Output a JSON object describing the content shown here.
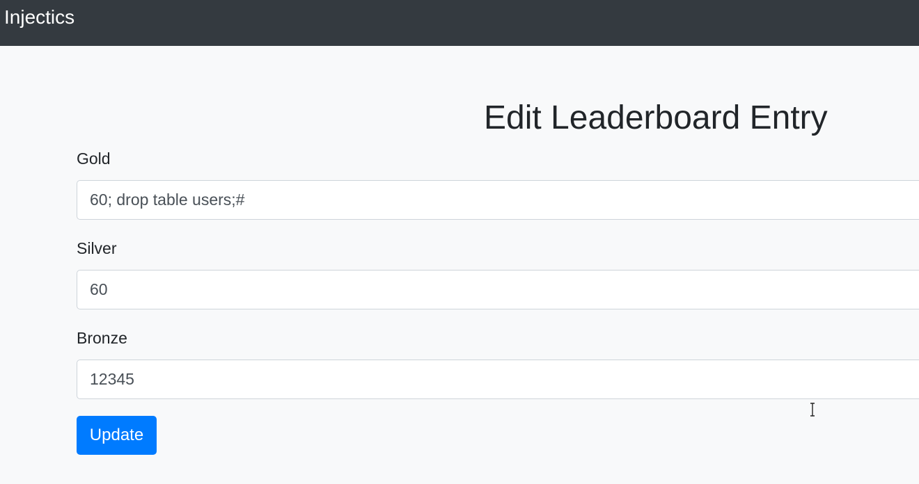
{
  "navbar": {
    "brand": "Injectics"
  },
  "page": {
    "title": "Edit Leaderboard Entry"
  },
  "form": {
    "gold": {
      "label": "Gold",
      "value": "60; drop table users;#"
    },
    "silver": {
      "label": "Silver",
      "value": "60"
    },
    "bronze": {
      "label": "Bronze",
      "value": "12345"
    },
    "submit_label": "Update"
  },
  "colors": {
    "navbar": "#343a40",
    "background": "#f8f9fa",
    "primary": "#007bff"
  },
  "icons": {
    "cursor": "text-cursor-icon"
  }
}
